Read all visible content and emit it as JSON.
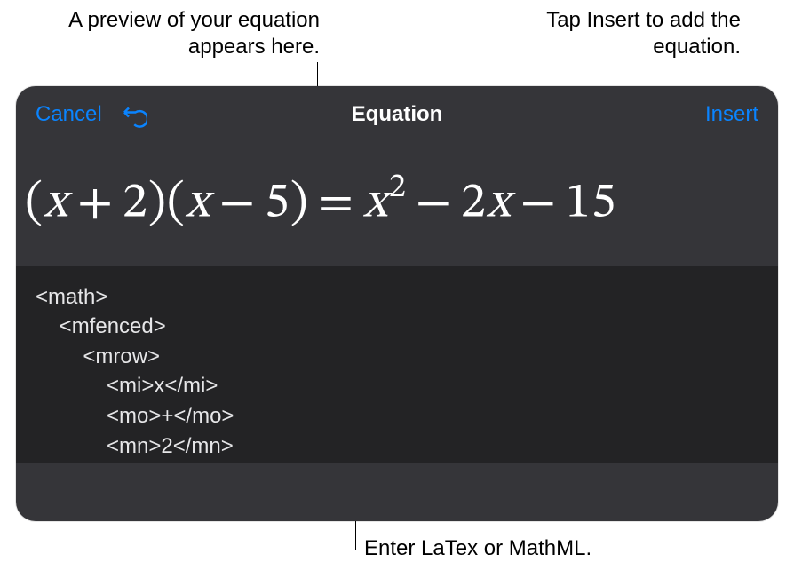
{
  "callouts": {
    "preview": "A preview of your equation appears here.",
    "insert": "Tap Insert to add the equation.",
    "input": "Enter LaTex or MathML."
  },
  "header": {
    "cancel_label": "Cancel",
    "title": "Equation",
    "insert_label": "Insert"
  },
  "preview": {
    "lp1": "(",
    "x1": "x",
    "plus": "+",
    "two": "2",
    "rp1": ")",
    "lp2": "(",
    "x2": "x",
    "minus1": "−",
    "five": "5",
    "rp2": ")",
    "equals": "=",
    "x3": "x",
    "sq": "2",
    "minus2": "−",
    "coef2": "2",
    "x4": "x",
    "minus3": "−",
    "fifteen": "15"
  },
  "code_lines": {
    "l1": "<math>",
    "l2": "    <mfenced>",
    "l3": "        <mrow>",
    "l4": "            <mi>x</mi>",
    "l5": "            <mo>+</mo>",
    "l6": "            <mn>2</mn>"
  }
}
